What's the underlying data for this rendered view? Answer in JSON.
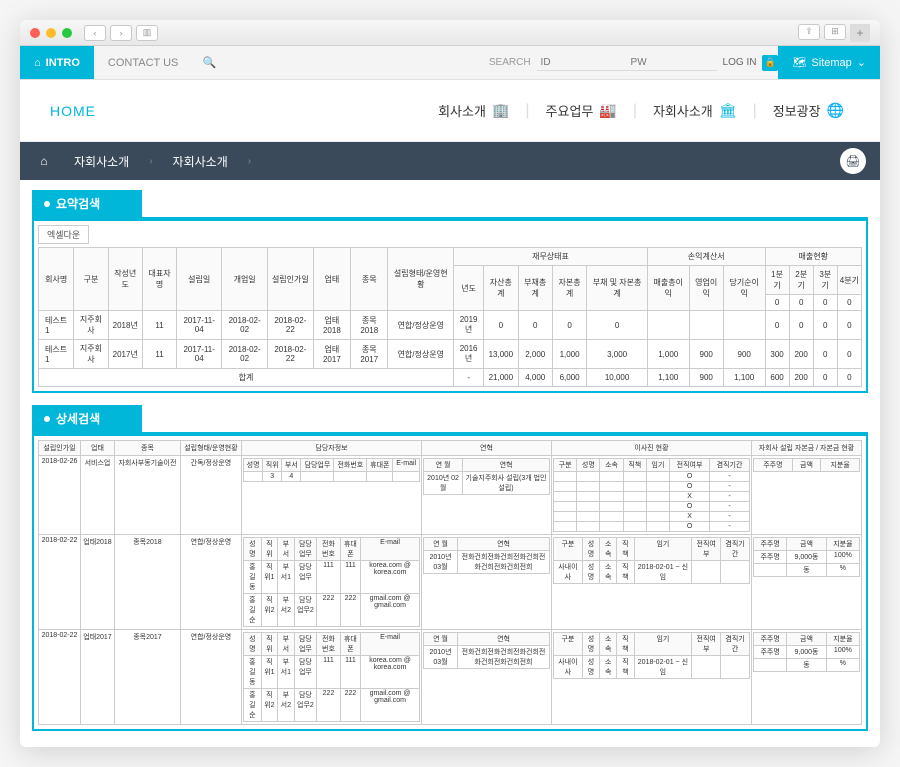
{
  "browser": {
    "plus": "+"
  },
  "topnav": {
    "intro": "INTRO",
    "contact": "CONTACT US",
    "search_label": "SEARCH",
    "id_placeholder": "ID",
    "pw_placeholder": "PW",
    "login": "LOG IN",
    "sitemap": "Sitemap"
  },
  "mainnav": {
    "home": "HOME",
    "items": [
      "회사소개",
      "주요업무",
      "자회사소개",
      "정보광장"
    ]
  },
  "breadcrumb": {
    "level1": "자회사소개",
    "level2": "자회사소개"
  },
  "sections": {
    "summary": "요약검색",
    "detail": "상세검색",
    "excel": "엑셀다운"
  },
  "summary": {
    "headers": {
      "company": "회사명",
      "type": "구분",
      "year": "작성년도",
      "ceo": "대표자명",
      "established": "설립일",
      "opened": "개업일",
      "approved": "설립인가일",
      "biz": "업태",
      "item": "종목",
      "form": "설립형태/운영현황",
      "fin_group": "재무상태표",
      "pl_group": "손익계산서",
      "sales_group": "매출현황",
      "fin_year": "년도",
      "assets": "자산총계",
      "liab": "부채총계",
      "cap": "자본총계",
      "liabcap": "부채 및 자본총계",
      "rev": "매출총이익",
      "op": "영업이익",
      "net": "당기순이익",
      "q1": "1분기",
      "q2": "2분기",
      "q3": "3분기",
      "q4": "4분기"
    },
    "rows": [
      {
        "company": "테스트1",
        "type": "지주회사",
        "year": "2018년",
        "ceo": "11",
        "est": "2017-11-04",
        "open": "2018-02-02",
        "appr": "2018-02-22",
        "biz": "업태2018",
        "item": "종목2018",
        "form": "연합/정상운영",
        "fyear": "2019년",
        "assets": "0",
        "liab": "0",
        "cap": "0",
        "lc": "0",
        "rev": "",
        "op": "",
        "net": "",
        "q1": "0",
        "q2": "0",
        "q3": "0",
        "q4": "0"
      },
      {
        "company": "테스트1",
        "type": "지주회사",
        "year": "2017년",
        "ceo": "11",
        "est": "2017-11-04",
        "open": "2018-02-02",
        "appr": "2018-02-22",
        "biz": "업태2017",
        "item": "종목2017",
        "form": "연합/정상운영",
        "fyear": "2016년",
        "assets": "13,000",
        "liab": "2,000",
        "cap": "1,000",
        "lc": "3,000",
        "rev": "1,000",
        "op": "900",
        "net": "900",
        "q1": "300",
        "q2": "200",
        "q3": "0",
        "q4": "0"
      }
    ],
    "total_label": "합계",
    "totals": {
      "fyear": "-",
      "assets": "21,000",
      "liab": "4,000",
      "cap": "6,000",
      "lc": "10,000",
      "rev": "1,100",
      "op": "900",
      "net": "1,100",
      "q1": "600",
      "q2": "200",
      "q3": "0",
      "q4": "0"
    },
    "init_q": {
      "q1": "0",
      "q2": "0",
      "q3": "0",
      "q4": "0"
    }
  },
  "detail": {
    "headers": {
      "approved": "설립인가일",
      "biz": "업태",
      "item": "종목",
      "form": "설립형태/운영현황",
      "manager_group": "담당자정보",
      "history_group": "연혁",
      "director_group": "이사진 현황",
      "capital_group": "자회사 설립 자본금 / 자본금 현황",
      "name": "성명",
      "pos": "직위",
      "dept": "부서",
      "duty": "담당업무",
      "phone": "전화번호",
      "mobile": "휴대폰",
      "email": "E-mail",
      "ym": "연 월",
      "hist": "연혁",
      "dtype": "구분",
      "dname": "성명",
      "daffil": "소속",
      "dpos": "직책",
      "dterm": "임기",
      "dfull": "전직여부",
      "dsame": "겸직기간",
      "shareholder": "주주명",
      "amount": "금액",
      "ratio": "지분율"
    },
    "rows": [
      {
        "appr": "2018-02-26",
        "biz": "서비스업",
        "item": "자회사부동기술이전",
        "form": "간독/정상운영",
        "managers": [
          {
            "name": "",
            "pos": "3",
            "dept": "4",
            "duty": "",
            "phone": "",
            "mobile": "",
            "email": ""
          }
        ],
        "history": [
          {
            "ym": "2010년 02월",
            "txt": "기술지주회사 설립(3개 법인 설립)"
          }
        ],
        "directors": [
          {
            "t": "",
            "n": "",
            "a": "",
            "p": "",
            "term": "",
            "full": "O",
            "same": "-"
          },
          {
            "t": "",
            "n": "",
            "a": "",
            "p": "",
            "term": "",
            "full": "O",
            "same": "-"
          },
          {
            "t": "",
            "n": "",
            "a": "",
            "p": "",
            "term": "",
            "full": "X",
            "same": "-"
          },
          {
            "t": "",
            "n": "",
            "a": "",
            "p": "",
            "term": "",
            "full": "O",
            "same": "-"
          },
          {
            "t": "",
            "n": "",
            "a": "",
            "p": "",
            "term": "",
            "full": "X",
            "same": "-"
          },
          {
            "t": "",
            "n": "",
            "a": "",
            "p": "",
            "term": "",
            "full": "O",
            "same": "-"
          }
        ],
        "capital": []
      },
      {
        "appr": "2018-02-22",
        "biz": "업태2018",
        "item": "종목2018",
        "form": "연합/정상운영",
        "managers": [
          {
            "name": "홍길동",
            "pos": "직위1",
            "dept": "부서1",
            "duty": "담당업무",
            "phone": "111",
            "mobile": "111",
            "email": "korea.com @ korea.com"
          },
          {
            "name": "홍길순",
            "pos": "직위2",
            "dept": "부서2",
            "duty": "담당업무2",
            "phone": "222",
            "mobile": "222",
            "email": "gmail.com @ gmail.com"
          }
        ],
        "history": [
          {
            "ym": "2010년 03월",
            "txt": "전화건희전화건희전화건희전화건희전화건희전희"
          }
        ],
        "directors": [
          {
            "t": "사내이사",
            "n": "성명",
            "a": "소속",
            "p": "직책",
            "term": "2018-02-01 ~ 신임",
            "full": "",
            "same": ""
          }
        ],
        "capital": [
          {
            "sh": "주주명",
            "amt": "9,000동",
            "ratio": "100%"
          },
          {
            "sh": "",
            "amt": "동",
            "ratio": "%"
          }
        ]
      },
      {
        "appr": "2018-02-22",
        "biz": "업태2017",
        "item": "종목2017",
        "form": "연합/정상운영",
        "managers": [
          {
            "name": "홍길동",
            "pos": "직위1",
            "dept": "부서1",
            "duty": "담당업무",
            "phone": "111",
            "mobile": "111",
            "email": "korea.com @ korea.com"
          },
          {
            "name": "홍길순",
            "pos": "직위2",
            "dept": "부서2",
            "duty": "담당업무2",
            "phone": "222",
            "mobile": "222",
            "email": "gmail.com @ gmail.com"
          }
        ],
        "history": [
          {
            "ym": "2010년 03월",
            "txt": "전화건희전화건희전화건희전화건희전화건희전희"
          }
        ],
        "directors": [
          {
            "t": "사내이사",
            "n": "성명",
            "a": "소속",
            "p": "직책",
            "term": "2018-02-01 ~ 신임",
            "full": "",
            "same": ""
          }
        ],
        "capital": [
          {
            "sh": "주주명",
            "amt": "9,000동",
            "ratio": "100%"
          },
          {
            "sh": "",
            "amt": "동",
            "ratio": "%"
          }
        ]
      }
    ]
  }
}
